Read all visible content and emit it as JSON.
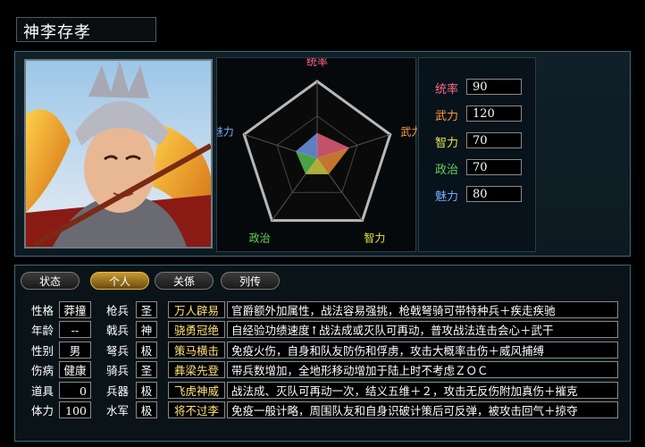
{
  "character": {
    "name": "神李存孝"
  },
  "radar": {
    "labels": [
      {
        "key": "lead",
        "text": "统率",
        "color": "#ff6b8a"
      },
      {
        "key": "war",
        "text": "武力",
        "color": "#ff9a3a"
      },
      {
        "key": "int",
        "text": "智力",
        "color": "#e6e64a"
      },
      {
        "key": "pol",
        "text": "政治",
        "color": "#62d45a"
      },
      {
        "key": "chr",
        "text": "魅力",
        "color": "#7aa8ff"
      }
    ]
  },
  "stats": [
    {
      "label": "统率",
      "value": "90",
      "color": "#ff6b8a"
    },
    {
      "label": "武力",
      "value": "120",
      "color": "#ff9a3a"
    },
    {
      "label": "智力",
      "value": "70",
      "color": "#e6e64a"
    },
    {
      "label": "政治",
      "value": "70",
      "color": "#62d45a"
    },
    {
      "label": "魅力",
      "value": "80",
      "color": "#7aa8ff"
    }
  ],
  "tabs": [
    "状态",
    "个人",
    "关係",
    "列传"
  ],
  "active_tab": 1,
  "personal": [
    {
      "label": "性格",
      "value": "莽撞"
    },
    {
      "label": "年龄",
      "value": "--"
    },
    {
      "label": "性别",
      "value": "男"
    },
    {
      "label": "伤病",
      "value": "健康"
    },
    {
      "label": "道具",
      "value": "0"
    },
    {
      "label": "体力",
      "value": "100"
    }
  ],
  "troops": [
    {
      "label": "枪兵",
      "value": "圣"
    },
    {
      "label": "戟兵",
      "value": "神"
    },
    {
      "label": "弩兵",
      "value": "极"
    },
    {
      "label": "骑兵",
      "value": "圣"
    },
    {
      "label": "兵器",
      "value": "极"
    },
    {
      "label": "水军",
      "value": "极"
    }
  ],
  "skills": [
    {
      "name": "万人辟易",
      "desc": "官爵额外加属性，战法容易强挑，枪戟弩骑可带特种兵＋疾走疾驰"
    },
    {
      "name": "骁勇冠绝",
      "desc": "自经验功绩速度↑战法成或灭队可再动，普攻战法连击会心＋武干"
    },
    {
      "name": "策马横击",
      "desc": "免疫火伤，自身和队友防伤和俘虏，攻击大概率击伤＋威风捕缚"
    },
    {
      "name": "彝梁先登",
      "desc": "带兵数增加，全地形移动增加于陆上时不考虑ＺＯＣ"
    },
    {
      "name": "飞虎神威",
      "desc": "战法成、灭队可再动一次，结义五维＋２，攻击无反伤附加真伤＋摧克"
    },
    {
      "name": "将不过李",
      "desc": "免疫一般计略，周围队友和自身识破计策后可反弹，被攻击回气＋掠夺"
    }
  ]
}
